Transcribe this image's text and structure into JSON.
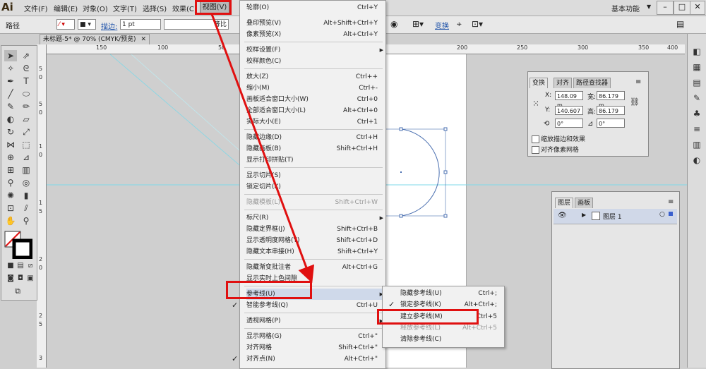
{
  "app": {
    "logo": "Ai"
  },
  "menubar": {
    "items": [
      "文件(F)",
      "编辑(E)",
      "对象(O)",
      "文字(T)",
      "选择(S)",
      "效果(C)",
      "视图(V)"
    ],
    "workspace": "基本功能",
    "min": "–",
    "max": "□",
    "close": "✕"
  },
  "controlbar": {
    "path_label": "路径",
    "stroke_label": "描边:",
    "stroke_value": "1 pt",
    "stroke_profile": "等比",
    "transform_link": "变换"
  },
  "document": {
    "tab_title": "未标题-5* @ 70% (CMYK/预览)",
    "close": "✕"
  },
  "ruler": {
    "h_labels": [
      "150",
      "100",
      "50",
      "200",
      "250",
      "300",
      "350",
      "400"
    ],
    "v_labels": [
      "5",
      "0",
      "5",
      "0",
      "1",
      "0",
      "1",
      "5",
      "2",
      "0",
      "2",
      "5",
      "3"
    ]
  },
  "view_menu": {
    "items": [
      {
        "label": "轮廓(O)",
        "shortcut": "Ctrl+Y"
      },
      {
        "label": "叠印预览(V)",
        "shortcut": "Alt+Shift+Ctrl+Y"
      },
      {
        "label": "像素预览(X)",
        "shortcut": "Alt+Ctrl+Y"
      },
      {
        "label": "校样设置(F)",
        "shortcut": ""
      },
      {
        "label": "校样颜色(C)",
        "shortcut": ""
      },
      {
        "label": "放大(Z)",
        "shortcut": "Ctrl++"
      },
      {
        "label": "缩小(M)",
        "shortcut": "Ctrl+-"
      },
      {
        "label": "画板适合窗口大小(W)",
        "shortcut": "Ctrl+0"
      },
      {
        "label": "全部适合窗口大小(L)",
        "shortcut": "Alt+Ctrl+0"
      },
      {
        "label": "实际大小(E)",
        "shortcut": "Ctrl+1"
      },
      {
        "label": "隐藏边缘(D)",
        "shortcut": "Ctrl+H"
      },
      {
        "label": "隐藏画板(B)",
        "shortcut": "Shift+Ctrl+H"
      },
      {
        "label": "显示打印拼贴(T)",
        "shortcut": ""
      },
      {
        "label": "显示切片(S)",
        "shortcut": ""
      },
      {
        "label": "锁定切片(K)",
        "shortcut": ""
      },
      {
        "label": "隐藏模板(L)",
        "shortcut": "Shift+Ctrl+W"
      },
      {
        "label": "标尺(R)",
        "shortcut": ""
      },
      {
        "label": "隐藏定界框(J)",
        "shortcut": "Shift+Ctrl+B"
      },
      {
        "label": "显示透明度网格(Y)",
        "shortcut": "Shift+Ctrl+D"
      },
      {
        "label": "隐藏文本串接(H)",
        "shortcut": "Shift+Ctrl+Y"
      },
      {
        "label": "隐藏渐变批注者",
        "shortcut": "Alt+Ctrl+G"
      },
      {
        "label": "显示实时上色间隙",
        "shortcut": ""
      },
      {
        "label": "参考线(U)",
        "shortcut": ""
      },
      {
        "label": "智能参考线(Q)",
        "shortcut": "Ctrl+U"
      },
      {
        "label": "透视网格(P)",
        "shortcut": ""
      },
      {
        "label": "显示网格(G)",
        "shortcut": "Ctrl+\""
      },
      {
        "label": "对齐网格",
        "shortcut": "Shift+Ctrl+\""
      },
      {
        "label": "对齐点(N)",
        "shortcut": "Alt+Ctrl+\""
      }
    ],
    "checkmark": "✓"
  },
  "guides_submenu": {
    "items": [
      {
        "label": "隐藏参考线(U)",
        "shortcut": "Ctrl+;"
      },
      {
        "label": "锁定参考线(K)",
        "shortcut": "Alt+Ctrl+;"
      },
      {
        "label": "建立参考线(M)",
        "shortcut": "Ctrl+5"
      },
      {
        "label": "释放参考线(L)",
        "shortcut": "Alt+Ctrl+5"
      },
      {
        "label": "清除参考线(C)",
        "shortcut": ""
      }
    ]
  },
  "transform_panel": {
    "tabs": [
      "变换",
      "对齐",
      "路径查找器"
    ],
    "x_label": "X:",
    "x_value": "148.09 m",
    "y_label": "Y:",
    "y_value": "140.607",
    "w_label": "宽:",
    "w_value": "86.179 m",
    "h_label": "高:",
    "h_value": "86.179 m",
    "rotate_value": "0°",
    "shear_value": "0°",
    "scale_strokes": "缩放描边和效果",
    "align_pixel": "对齐像素网格"
  },
  "layers_panel": {
    "tabs": [
      "图层",
      "画板"
    ],
    "layer_name": "图层 1"
  },
  "colors": {
    "annotation_red": "#e01010",
    "guide_cyan": "#7fd8e8",
    "selection_blue": "#4a6fb0"
  }
}
